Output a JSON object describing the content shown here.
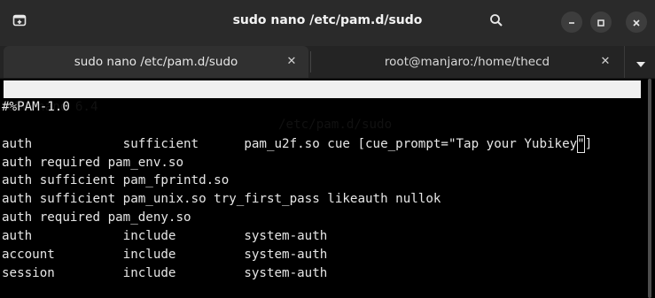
{
  "window": {
    "title": "sudo nano /etc/pam.d/sudo"
  },
  "tabs": [
    {
      "label": "sudo nano /etc/pam.d/sudo",
      "active": true
    },
    {
      "label": "root@manjaro:/home/thecd",
      "active": false
    }
  ],
  "icons": {
    "new_tab": "new-tab-icon",
    "search": "search-icon",
    "minimize": "minimize-icon",
    "maximize": "maximize-icon",
    "close": "close-icon",
    "tab_close": "tab-close-icon",
    "tab_menu": "chevron-down-icon"
  },
  "colors": {
    "titlebar_bg": "#2a2a2a",
    "tab_active_bg": "#303030",
    "terminal_bg": "#000000",
    "terminal_fg": "#e6e6e6",
    "nano_header_bg": "#f0f0f0"
  },
  "editor": {
    "version": "GNU nano 6.4",
    "filename": "/etc/pam.d/sudo",
    "lines": [
      "#%PAM-1.0",
      "",
      "auth            sufficient      pam_u2f.so cue [cue_prompt=\"Tap your Yubikey",
      "auth required pam_env.so",
      "auth sufficient pam_fprintd.so",
      "auth sufficient pam_unix.so try_first_pass likeauth nullok",
      "auth required pam_deny.so",
      "auth            include         system-auth",
      "account         include         system-auth",
      "session         include         system-auth"
    ],
    "cursor_char": "\"",
    "line3_tail": "]"
  }
}
